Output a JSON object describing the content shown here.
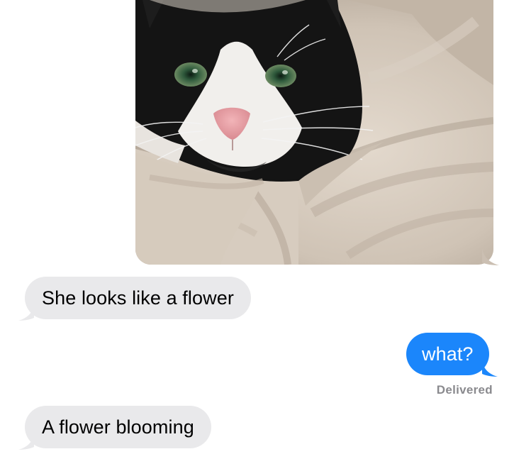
{
  "conversation": {
    "photo": {
      "description_icon": "cat-photo"
    },
    "messages": [
      {
        "direction": "received",
        "text": "She looks like a flower"
      },
      {
        "direction": "sent",
        "text": "what?"
      },
      {
        "direction": "received",
        "text": "A flower blooming"
      }
    ],
    "delivery_status": "Delivered"
  },
  "colors": {
    "sent_bubble": "#1b86fb",
    "received_bubble": "#e9e9eb",
    "receipt_text": "#8a8a8e",
    "background": "#ffffff"
  }
}
